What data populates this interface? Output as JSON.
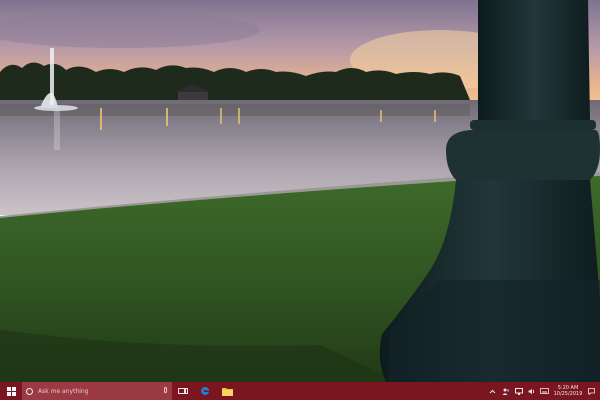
{
  "desktop": {
    "wallpaper": "lakeside sunset with fountain and lamp post"
  },
  "taskbar": {
    "color": "#7a1620",
    "start_icon": "windows-logo-icon",
    "search": {
      "placeholder": "Ask me anything"
    },
    "pinned": [
      {
        "name": "task-view-icon"
      },
      {
        "name": "edge-icon",
        "color": "#1e7fd6"
      },
      {
        "name": "file-explorer-icon",
        "color": "#f0c43c"
      }
    ],
    "tray": {
      "icons": [
        "chevron-up-icon",
        "people-icon",
        "network-icon",
        "volume-icon",
        "keyboard-icon"
      ],
      "time": "5:20 AM",
      "date": "10/25/2019"
    }
  }
}
